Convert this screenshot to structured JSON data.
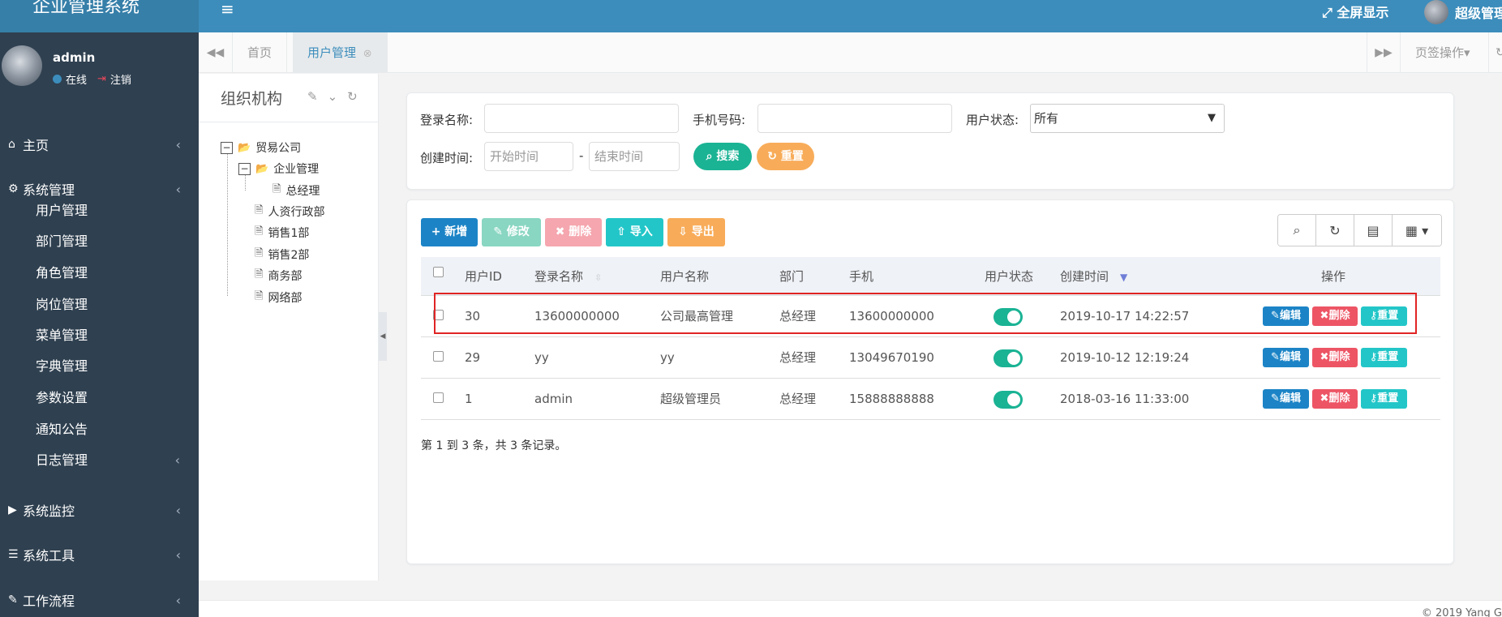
{
  "header": {
    "brand": "企业管理系统",
    "fullscreen_label": "全屏显示",
    "user_label": "超级管理"
  },
  "sidebar": {
    "username": "admin",
    "online_label": "在线",
    "logout_label": "注销",
    "menus": [
      {
        "label": "主页"
      },
      {
        "label": "系统管理"
      },
      {
        "label": "系统监控"
      },
      {
        "label": "系统工具"
      },
      {
        "label": "工作流程"
      }
    ],
    "sub_items": [
      "用户管理",
      "部门管理",
      "角色管理",
      "岗位管理",
      "菜单管理",
      "字典管理",
      "参数设置",
      "通知公告",
      "日志管理"
    ]
  },
  "tabs": {
    "home": "首页",
    "active": "用户管理",
    "page_ops": "页签操作"
  },
  "org": {
    "title": "组织机构",
    "tree": {
      "root": "贸易公司",
      "group": "企业管理",
      "child": "总经理",
      "others": [
        "人资行政部",
        "销售1部",
        "销售2部",
        "商务部",
        "网络部"
      ]
    }
  },
  "search": {
    "login_label": "登录名称:",
    "phone_label": "手机号码:",
    "status_label": "用户状态:",
    "status_value": "所有",
    "created_label": "创建时间:",
    "start_placeholder": "开始时间",
    "end_placeholder": "结束时间",
    "dash": "-",
    "search_btn": "搜索",
    "reset_btn": "重置"
  },
  "toolbar": {
    "add": "新增",
    "edit": "修改",
    "delete": "删除",
    "import": "导入",
    "export": "导出"
  },
  "table": {
    "columns": [
      "用户ID",
      "登录名称",
      "用户名称",
      "部门",
      "手机",
      "用户状态",
      "创建时间",
      "操作"
    ],
    "rows": [
      {
        "id": "30",
        "login": "13600000000",
        "name": "公司最高管理",
        "dept": "总经理",
        "phone": "13600000000",
        "status_on": true,
        "created": "2019-10-17 14:22:57"
      },
      {
        "id": "29",
        "login": "yy",
        "name": "yy",
        "dept": "总经理",
        "phone": "13049670190",
        "status_on": true,
        "created": "2019-10-12 12:19:24"
      },
      {
        "id": "1",
        "login": "admin",
        "name": "超级管理员",
        "dept": "总经理",
        "phone": "15888888888",
        "status_on": true,
        "created": "2018-03-16 11:33:00"
      }
    ],
    "op_edit": "编辑",
    "op_delete": "删除",
    "op_reset": "重置",
    "page_info": "第 1 到 3 条，共 3 条记录。"
  },
  "footer": {
    "copyright": "© 2019 Yang G"
  },
  "colors": {
    "primary": "#3c8dbc",
    "success": "#1ab394",
    "danger": "#ed5565",
    "info": "#23c6c8",
    "warning": "#f8ac59",
    "sidebar": "#2f4050",
    "highlight": "#e02424"
  }
}
